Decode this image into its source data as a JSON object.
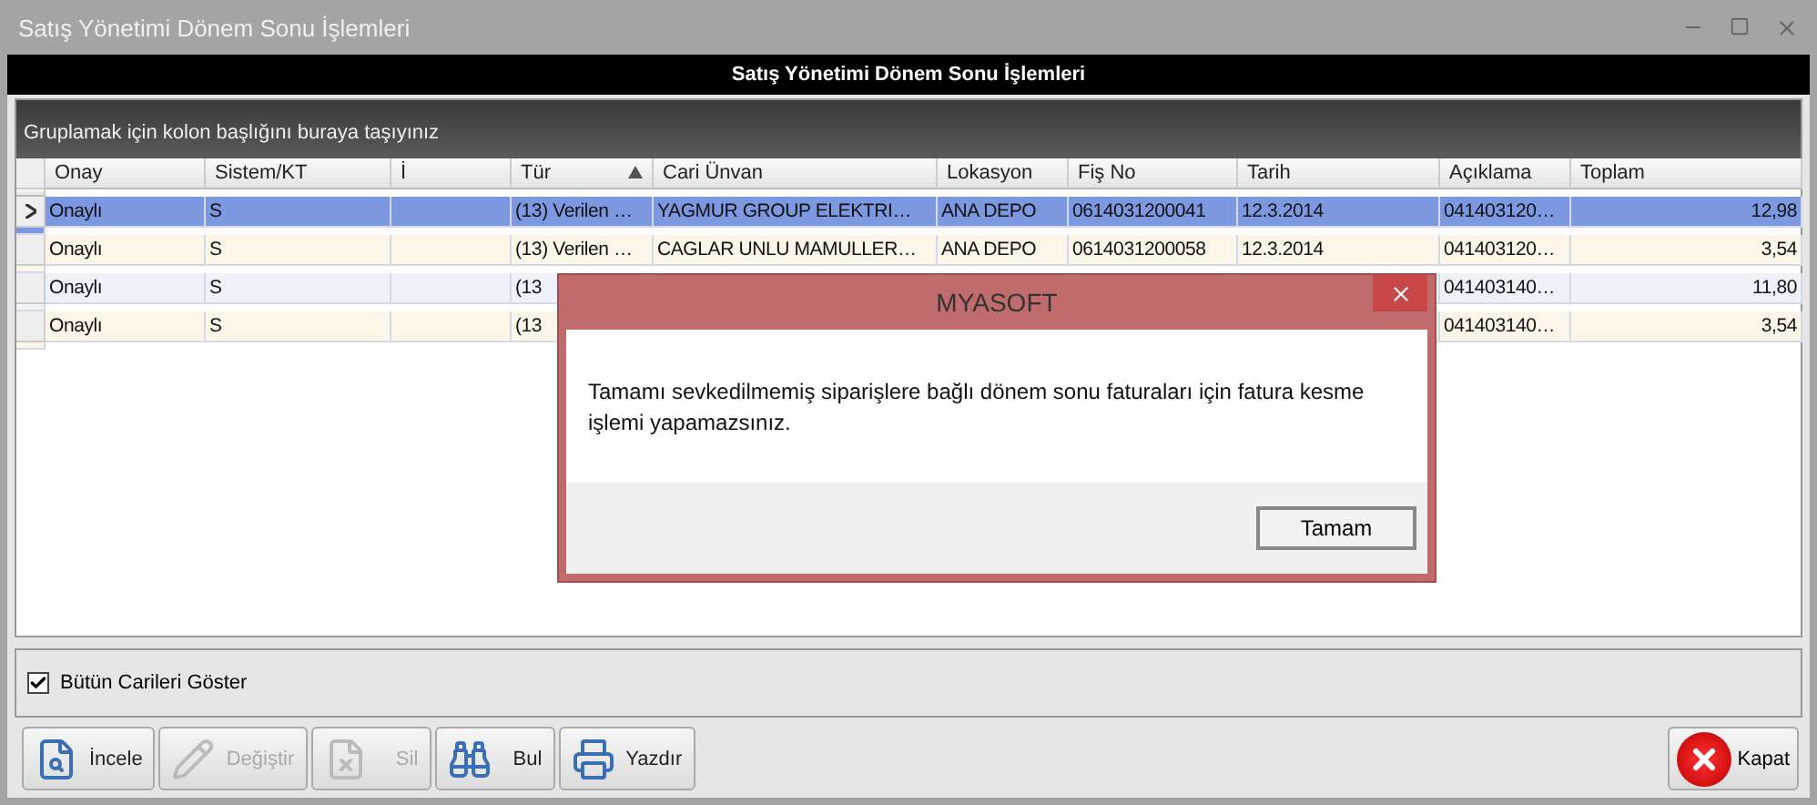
{
  "window": {
    "title": "Satış Yönetimi Dönem Sonu İşlemleri"
  },
  "header": "Satış Yönetimi Dönem Sonu İşlemleri",
  "group_hint": "Gruplamak için kolon başlığını buraya taşıyınız",
  "table": {
    "columns": [
      {
        "label": "Onay",
        "sorted": false
      },
      {
        "label": "Sistem/KT",
        "sorted": false
      },
      {
        "label": "İ",
        "sorted": false
      },
      {
        "label": "Tür",
        "sorted": true
      },
      {
        "label": "Cari Ünvan",
        "sorted": false
      },
      {
        "label": "Lokasyon",
        "sorted": false
      },
      {
        "label": "Fiş No",
        "sorted": false
      },
      {
        "label": "Tarih",
        "sorted": false
      },
      {
        "label": "Açıklama",
        "sorted": false
      },
      {
        "label": "Toplam",
        "sorted": false
      }
    ],
    "rows": [
      {
        "selected": true,
        "cells": [
          "Onaylı",
          "S",
          null,
          "(13) Verilen …",
          "YAGMUR GROUP ELEKTRI…",
          "ANA DEPO",
          "0614031200041",
          "12.3.2014",
          "041403120…",
          "12,98"
        ]
      },
      {
        "selected": false,
        "cells": [
          "Onaylı",
          "S",
          null,
          "(13) Verilen …",
          "CAGLAR UNLU MAMULLER…",
          "ANA DEPO",
          "0614031200058",
          "12.3.2014",
          "041403120…",
          "3,54"
        ]
      },
      {
        "selected": false,
        "cells": [
          "Onaylı",
          "S",
          null,
          "(13",
          null,
          null,
          null,
          null,
          "041403140…",
          "11,80"
        ]
      },
      {
        "selected": false,
        "cells": [
          "Onaylı",
          "S",
          null,
          "(13",
          null,
          null,
          null,
          null,
          "041403140…",
          "3,54"
        ]
      }
    ]
  },
  "show_all": {
    "label": "Bütün Carileri Göster",
    "checked": true
  },
  "buttons": [
    {
      "kind": "inspect",
      "label": "İncele",
      "disabled": false
    },
    {
      "kind": "edit",
      "label": "Değiştir",
      "disabled": true
    },
    {
      "kind": "delete",
      "label": "Sil",
      "disabled": true
    },
    {
      "kind": "find",
      "label": "Bul",
      "disabled": false
    },
    {
      "kind": "print",
      "label": "Yazdır",
      "disabled": false
    }
  ],
  "close_button": {
    "label": "Kapat"
  },
  "dialog": {
    "title": "MYASOFT",
    "message": "Tamamı sevkedilmemiş siparişlere bağlı dönem sonu faturaları için fatura kesme işlemi yapamazsınız.",
    "button": "Tamam"
  }
}
